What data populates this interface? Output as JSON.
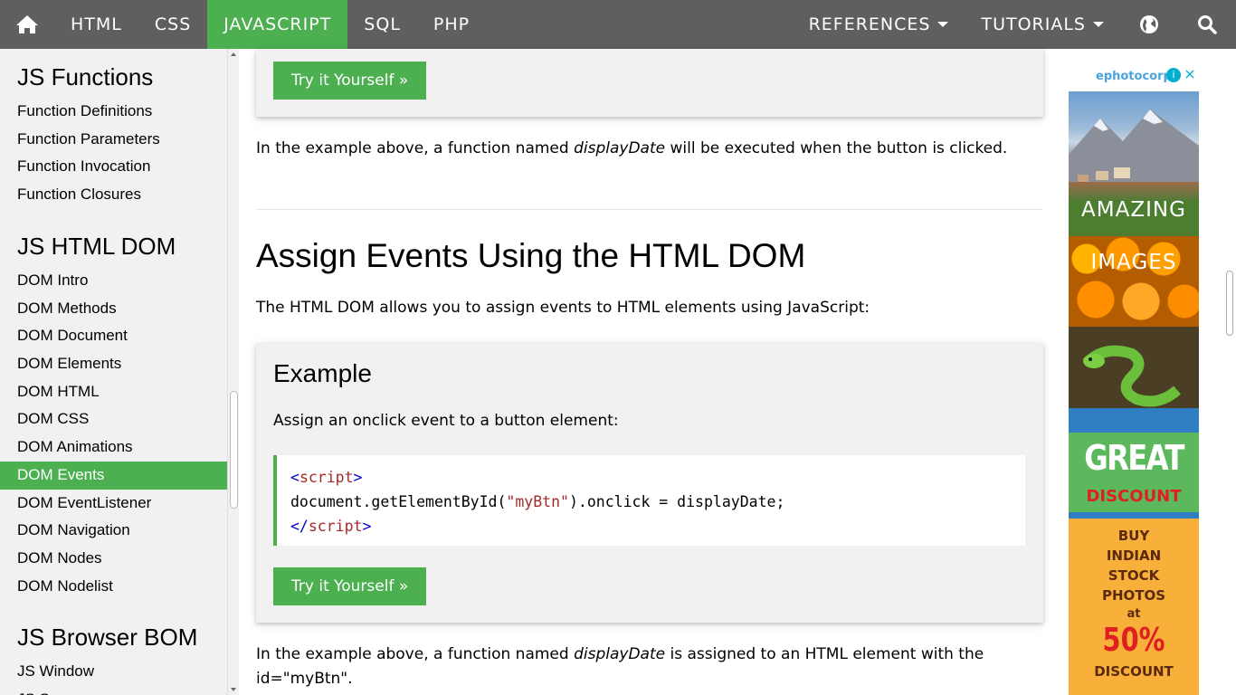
{
  "nav": {
    "home_icon": "home-icon",
    "items": [
      "HTML",
      "CSS",
      "JAVASCRIPT",
      "SQL",
      "PHP"
    ],
    "active": "JAVASCRIPT",
    "references": "REFERENCES",
    "tutorials": "TUTORIALS",
    "globe_icon": "globe-icon",
    "search_icon": "search-icon",
    "colors": {
      "bar": "#5f5f5f",
      "accent": "#4caf50"
    }
  },
  "sidebar": {
    "sections": [
      {
        "title": "JS Functions",
        "links": [
          "Function Definitions",
          "Function Parameters",
          "Function Invocation",
          "Function Closures"
        ]
      },
      {
        "title": "JS HTML DOM",
        "links": [
          "DOM Intro",
          "DOM Methods",
          "DOM Document",
          "DOM Elements",
          "DOM HTML",
          "DOM CSS",
          "DOM Animations",
          "DOM Events",
          "DOM EventListener",
          "DOM Navigation",
          "DOM Nodes",
          "DOM Nodelist"
        ]
      },
      {
        "title": "JS Browser BOM",
        "links": [
          "JS Window",
          "JS Screen"
        ]
      }
    ],
    "active_link": "DOM Events"
  },
  "main": {
    "try_label": "Try it Yourself »",
    "para1_a": "In the example above, a function named ",
    "para1_em": "displayDate",
    "para1_b": " will be executed when the button is clicked.",
    "heading": "Assign Events Using the HTML DOM",
    "intro": "The HTML DOM allows you to assign events to HTML elements using JavaScript:",
    "example": {
      "title": "Example",
      "desc": "Assign an onclick event to a button element:",
      "code_open_lt": "<",
      "code_open_name": "script",
      "code_open_gt": ">",
      "code_line_a": "document.getElementById(",
      "code_line_str": "\"myBtn\"",
      "code_line_b": ").onclick = displayDate;",
      "code_close_lt": "</",
      "code_close_name": "script",
      "code_close_gt": ">"
    },
    "para2_a": "In the example above, a function named ",
    "para2_em": "displayDate",
    "para2_b": " is assigned to an HTML element with the id=\"myBtn\"."
  },
  "ad": {
    "brand": "ephotocorp",
    "info_icon": "info-icon",
    "close_icon": "close-icon",
    "amazing": "AMAZING",
    "images": "IMAGES",
    "great": "GREAT",
    "discount": "DISCOUNT",
    "buy_lines": [
      "BUY",
      "INDIAN",
      "STOCK",
      "PHOTOS",
      "at"
    ],
    "percent": "50%",
    "discount2": "DISCOUNT"
  }
}
